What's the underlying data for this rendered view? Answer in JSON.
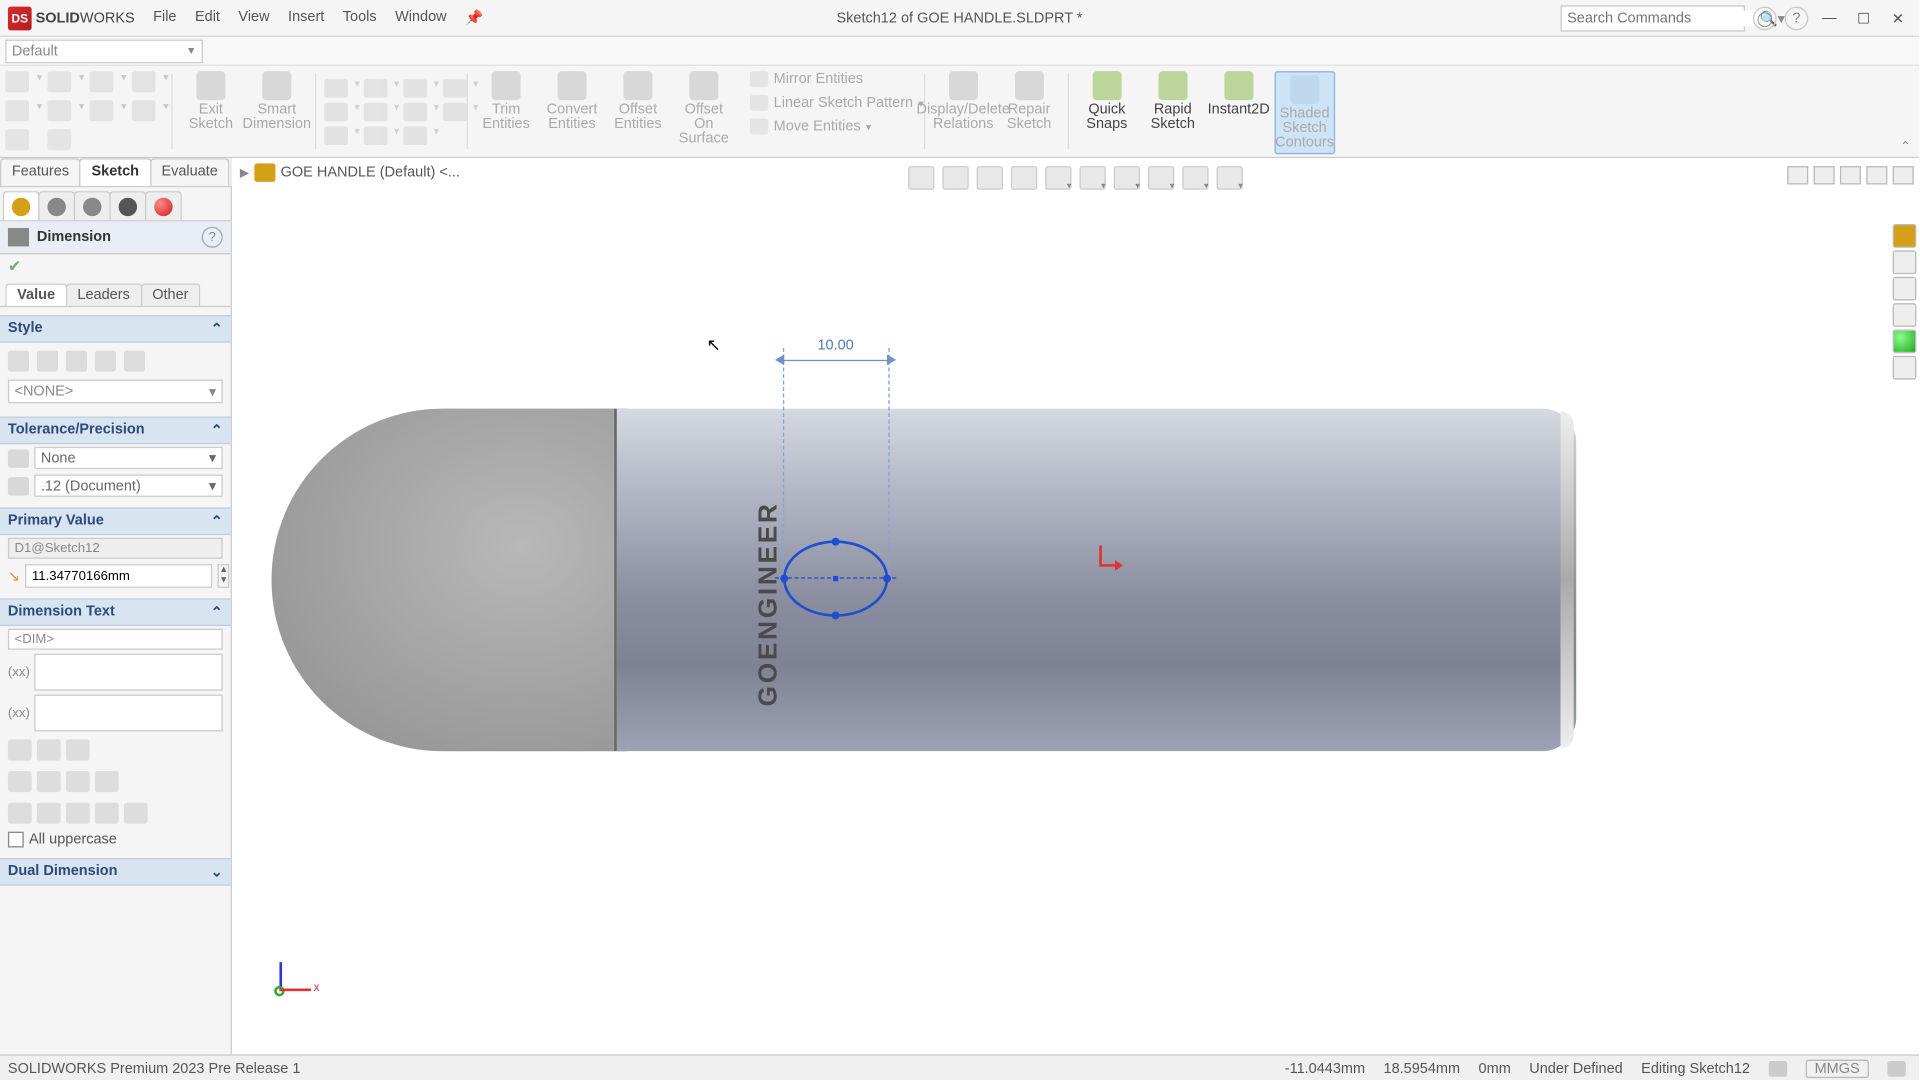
{
  "app": {
    "logo_text_a": "SOLID",
    "logo_text_b": "WORKS",
    "title": "Sketch12 of GOE HANDLE.SLDPRT *"
  },
  "menu": {
    "file": "File",
    "edit": "Edit",
    "view": "View",
    "insert": "Insert",
    "tools": "Tools",
    "window": "Window",
    "pin": "📌"
  },
  "search": {
    "placeholder": "Search Commands"
  },
  "config": {
    "current": "Default"
  },
  "ribbon": {
    "exit_sketch": "Exit\nSketch",
    "smart_dim": "Smart\nDimension",
    "trim": "Trim\nEntities",
    "convert": "Convert\nEntities",
    "offset": "Offset\nEntities",
    "offset_surf": "Offset\nOn\nSurface",
    "mirror": "Mirror Entities",
    "linear": "Linear Sketch Pattern",
    "move": "Move Entities",
    "disp_del": "Display/Delete\nRelations",
    "repair": "Repair\nSketch",
    "quick": "Quick\nSnaps",
    "rapid": "Rapid\nSketch",
    "instant": "Instant2D",
    "shaded": "Shaded\nSketch\nContours"
  },
  "cmdtabs": {
    "features": "Features",
    "sketch": "Sketch",
    "evaluate": "Evaluate"
  },
  "breadcrumb": {
    "name": "GOE HANDLE (Default) <..."
  },
  "pm": {
    "title": "Dimension",
    "tabs": {
      "value": "Value",
      "leaders": "Leaders",
      "other": "Other"
    },
    "style_h": "Style",
    "style_none": "<NONE>",
    "tol_h": "Tolerance/Precision",
    "tol_none": "None",
    "tol_doc": ".12 (Document)",
    "pv_h": "Primary Value",
    "pv_name": "D1@Sketch12",
    "pv_value": "11.34770166mm",
    "dt_h": "Dimension Text",
    "dt_placeholder": "<DIM>",
    "allupper": "All uppercase",
    "dual_h": "Dual Dimension"
  },
  "gfx": {
    "dim_value": "10.00",
    "etch_text": "GOENGINEER"
  },
  "triad": {
    "x": "x"
  },
  "status": {
    "product": "SOLIDWORKS Premium 2023 Pre Release 1",
    "coord_x": "-11.0443mm",
    "coord_y": "18.5954mm",
    "coord_z": "0mm",
    "state": "Under Defined",
    "mode": "Editing Sketch12",
    "units": "MMGS"
  }
}
